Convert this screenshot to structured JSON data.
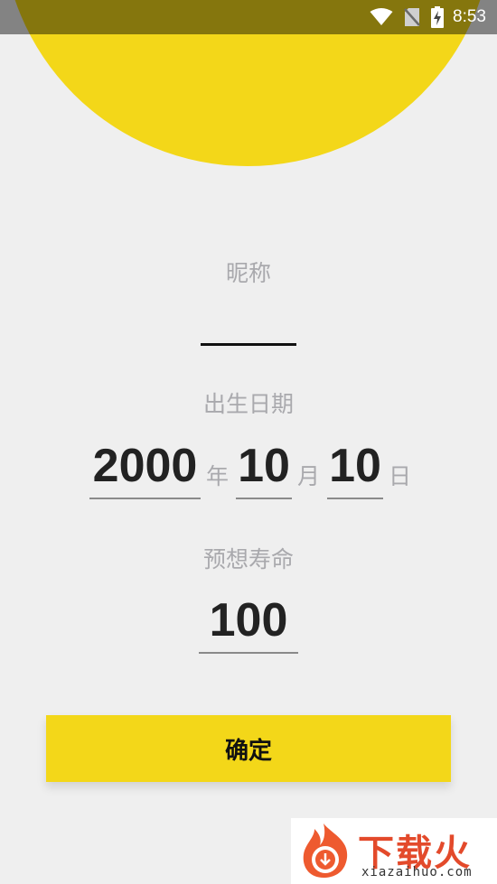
{
  "status_bar": {
    "time": "8:53",
    "icons": [
      "wifi-icon",
      "no-sim-icon",
      "battery-charging-icon"
    ]
  },
  "form": {
    "nickname": {
      "label": "昵称",
      "value": ""
    },
    "birth_date": {
      "label": "出生日期",
      "year": "2000",
      "year_unit": "年",
      "month": "10",
      "month_unit": "月",
      "day": "10",
      "day_unit": "日"
    },
    "life_expectancy": {
      "label": "预想寿命",
      "value": "100"
    },
    "confirm_label": "确定"
  },
  "watermark": {
    "text": "下载火",
    "sub": "xiazaihuo.com"
  },
  "colors": {
    "accent": "#f3d719",
    "background": "#efefef",
    "label": "#a9a9ad",
    "watermark": "#e34a2b"
  }
}
